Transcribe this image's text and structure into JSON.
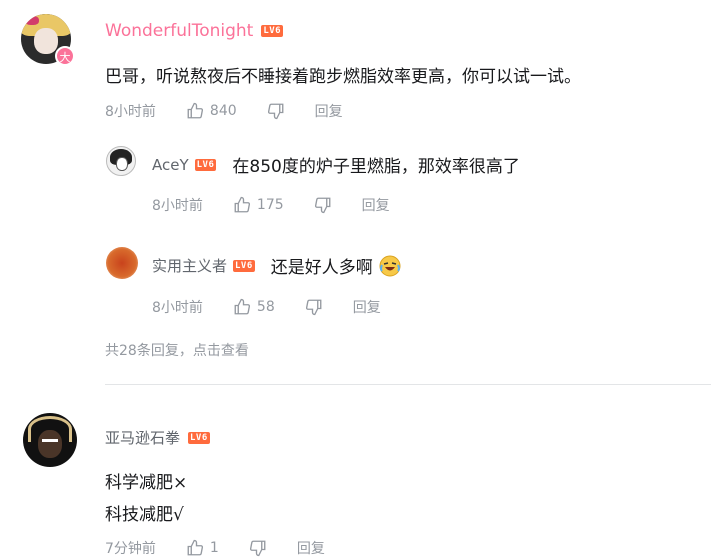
{
  "comment_main": {
    "username": "WonderfulTonight",
    "level": "LV6",
    "badge": "大",
    "text": "巴哥，听说熬夜后不睡接着跑步燃脂效率更高，你可以试一试。",
    "time": "8小时前",
    "likes": "840",
    "reply_label": "回复"
  },
  "replies": [
    {
      "username": "AceY",
      "level": "LV6",
      "text": "在850度的炉子里燃脂，那效率很高了",
      "time": "8小时前",
      "likes": "175",
      "reply_label": "回复"
    },
    {
      "username": "实用主义者",
      "level": "LV6",
      "text": "还是好人多啊",
      "emoji": "crying-laughing-emoji",
      "time": "8小时前",
      "likes": "58",
      "reply_label": "回复"
    }
  ],
  "more_replies": "共28条回复，点击查看",
  "comment_second": {
    "username": "亚马逊石拳",
    "level": "LV6",
    "line1": "科学减肥×",
    "line2": "科技减肥√",
    "time": "7分钟前",
    "likes": "1",
    "reply_label": "回复"
  },
  "colors": {
    "vip_name": "#fb7299",
    "level_badge": "#ff6b3d",
    "meta_text": "#9499a0"
  }
}
